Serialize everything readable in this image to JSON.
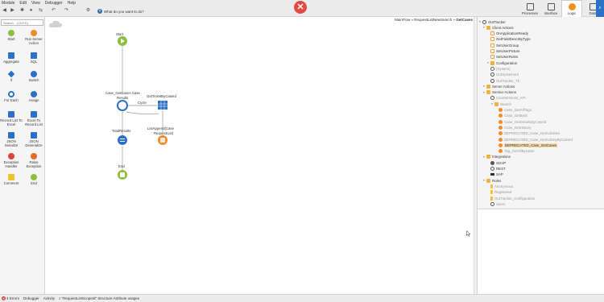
{
  "menu": [
    "Module",
    "Edit",
    "View",
    "Debugger",
    "Help"
  ],
  "toolbar": {
    "question": "What do you want to do?",
    "icons": [
      "back-icon",
      "forward-icon",
      "publish-icon",
      "debug-icon",
      "merge-icon",
      "undo-icon",
      "redo-icon",
      "manage-icon"
    ]
  },
  "layers": [
    {
      "label": "Processes",
      "icon": "processes-icon"
    },
    {
      "label": "Interface",
      "icon": "interface-icon"
    },
    {
      "label": "Logic",
      "icon": "logic-icon",
      "active": true
    },
    {
      "label": "Data",
      "icon": "data-icon"
    }
  ],
  "toolbox": {
    "search_placeholder": "Search... (Ctrl+E)",
    "tools": [
      {
        "label": "Start",
        "icon": "start-icon"
      },
      {
        "label": "Run Server Action",
        "icon": "run-server-action-icon"
      },
      {
        "label": "Aggregate",
        "icon": "aggregate-icon"
      },
      {
        "label": "SQL",
        "icon": "sql-icon"
      },
      {
        "label": "If",
        "icon": "if-icon"
      },
      {
        "label": "Switch",
        "icon": "switch-icon"
      },
      {
        "label": "For Each",
        "icon": "for-each-icon"
      },
      {
        "label": "Assign",
        "icon": "assign-icon"
      },
      {
        "label": "Record List To Excel",
        "icon": "record-list-to-excel-icon"
      },
      {
        "label": "Excel To Record List",
        "icon": "excel-to-record-list-icon"
      },
      {
        "label": "JSON Serialize",
        "icon": "json-serialize-icon"
      },
      {
        "label": "JSON Deserialize",
        "icon": "json-deserialize-icon"
      },
      {
        "label": "Exception Handler",
        "icon": "exception-handler-icon"
      },
      {
        "label": "Raise Exception",
        "icon": "raise-exception-icon"
      },
      {
        "label": "Comment",
        "icon": "comment-icon"
      },
      {
        "label": "End",
        "icon": "end-icon"
      }
    ]
  },
  "canvas": {
    "breadcrumb": {
      "path": "MainFlow » RequestListNewSearch » ",
      "current": "GetCases"
    },
    "nodes": {
      "start": "Start",
      "aggregate_line1": "Case_GetCases.Case",
      "aggregate_line2": "Results",
      "cycle": "Cycle",
      "get_ticket": "GetTicketByCaseId",
      "list_append_line1": "ListAppend(Case",
      "list_append_line2": "RequestList)",
      "total_results": "TotalResults",
      "end": "End"
    }
  },
  "tree": {
    "items": [
      {
        "label": "OutTracker",
        "icon": "module-icon",
        "level": 0
      },
      {
        "label": "Client Actions",
        "icon": "folder-icon",
        "level": 1
      },
      {
        "label": "OnApplicationReady",
        "icon": "client-action-icon",
        "level": 2
      },
      {
        "label": "GetFieldDescrByType",
        "icon": "client-action-icon",
        "level": 2
      },
      {
        "label": "SetUserGroup",
        "icon": "client-action-icon",
        "level": 2
      },
      {
        "label": "SetUserPicture",
        "icon": "client-action-icon",
        "level": 2
      },
      {
        "label": "SetUserRoles",
        "icon": "client-action-icon",
        "level": 2
      },
      {
        "label": "Configuration",
        "icon": "folder-icon",
        "level": 2
      },
      {
        "label": "(System)",
        "icon": "dependency-icon",
        "level": 2,
        "gray": true
      },
      {
        "label": "OutSystemsUI",
        "icon": "dependency-icon",
        "level": 2,
        "gray": true
      },
      {
        "label": "OutTracker_Th",
        "icon": "dependency-icon",
        "level": 2,
        "gray": true
      },
      {
        "label": "Server Actions",
        "icon": "folder-icon",
        "level": 1
      },
      {
        "label": "Service Actions",
        "icon": "folder-icon",
        "level": 1
      },
      {
        "label": "CaseServices_API",
        "icon": "dependency-icon",
        "level": 2,
        "gray": true
      },
      {
        "label": "Search",
        "icon": "folder-icon",
        "level": 3,
        "gray": true
      },
      {
        "label": "Case_GetAllTags",
        "icon": "service-action-icon",
        "level": 4,
        "gray": true
      },
      {
        "label": "Case_GetById",
        "icon": "service-action-icon",
        "level": 4,
        "gray": true
      },
      {
        "label": "Case_GetDetailsByCaseId",
        "icon": "service-action-icon",
        "level": 4,
        "gray": true
      },
      {
        "label": "Case_GetHistory",
        "icon": "service-action-icon",
        "level": 4,
        "gray": true
      },
      {
        "label": "DEPRECATED_Case_GetActivities",
        "icon": "service-action-icon",
        "level": 4,
        "gray": true
      },
      {
        "label": "DEPRECATED_Case_GetActivityByCaseId",
        "icon": "service-action-icon",
        "level": 4,
        "gray": true
      },
      {
        "label": "DEPRECATED_Case_GetCases",
        "icon": "service-action-icon",
        "level": 4,
        "selected": true
      },
      {
        "label": "Tag_GetAllByLabel",
        "icon": "service-action-icon",
        "level": 4,
        "gray": true
      },
      {
        "label": "Integrations",
        "icon": "folder-icon",
        "level": 1
      },
      {
        "label": "SOAP",
        "icon": "soap-icon",
        "level": 2
      },
      {
        "label": "REST",
        "icon": "rest-icon",
        "level": 2
      },
      {
        "label": "SAP",
        "icon": "sap-icon",
        "level": 2
      },
      {
        "label": "Roles",
        "icon": "folder-icon",
        "level": 1
      },
      {
        "label": "Anonymous",
        "icon": "role-icon",
        "level": 2,
        "gray": true
      },
      {
        "label": "Registered",
        "icon": "role-icon",
        "level": 2,
        "gray": true
      },
      {
        "label": "OutTracker_Configuration",
        "icon": "role-icon",
        "level": 2,
        "gray": true
      },
      {
        "label": "Users",
        "icon": "dependency-icon",
        "level": 2,
        "gray": true
      }
    ]
  },
  "status": {
    "errors": "4 Errors",
    "debugger": "Debugger",
    "activity": "Activity",
    "search": "\"RequestListScopeId\" Structure Attribute usages"
  },
  "colors": {
    "accent": "#2a71c8",
    "logic": "#f3901d",
    "start_green": "#8cbf3f",
    "error_red": "#e04b44",
    "selection": "#f7d9a8"
  }
}
